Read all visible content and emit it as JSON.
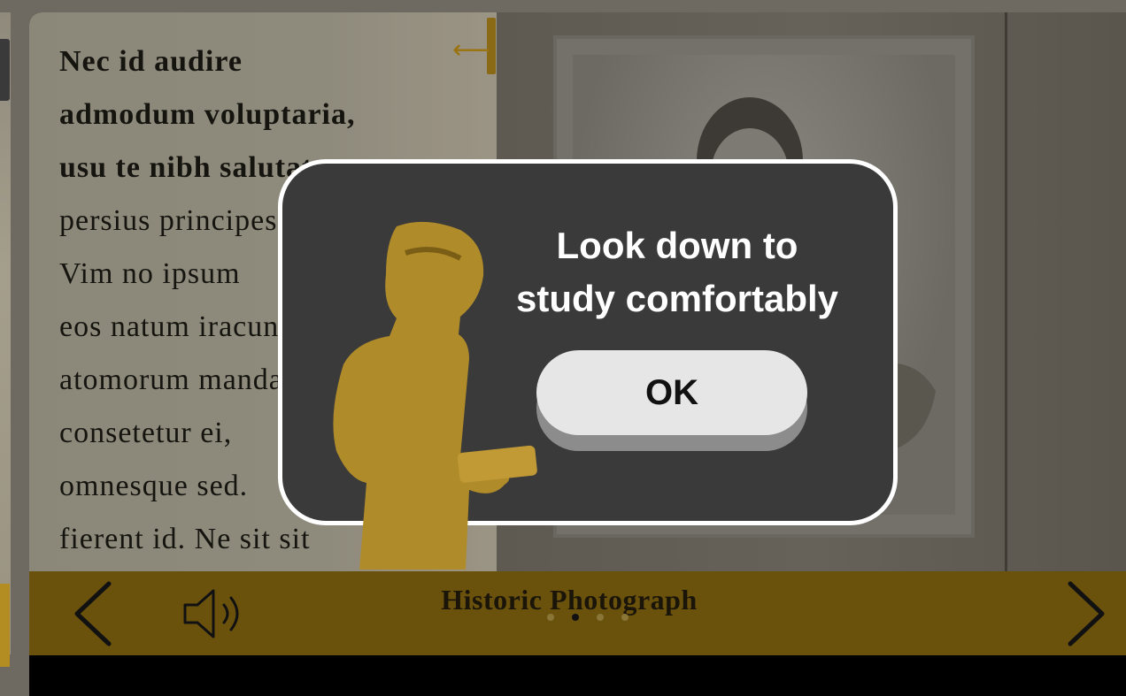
{
  "reader": {
    "body_lines": [
      {
        "text": "Nec id audire",
        "bold": true
      },
      {
        "text": "admodum voluptaria,",
        "bold": true
      },
      {
        "text": "usu te nibh salutatus",
        "bold": true
      },
      {
        "text": "persius principes",
        "bold": false
      },
      {
        "text": "Vim no ipsum",
        "bold": false
      },
      {
        "text": "eos natum iracundia",
        "bold": false
      },
      {
        "text": "atomorum mandamus",
        "bold": false
      },
      {
        "text": "consetetur ei,",
        "bold": false
      },
      {
        "text": "omnesque sed.",
        "bold": false
      },
      {
        "text": "fierent id. Ne sit sit",
        "bold": false
      }
    ]
  },
  "bottom_bar": {
    "title": "Historic Photograph",
    "page_dots": {
      "count": 4,
      "active_index": 1
    }
  },
  "modal": {
    "title": "Look down to\nstudy comfortably",
    "ok_label": "OK"
  },
  "icons": {
    "back": "arrow-left-icon",
    "prev": "chevron-left-icon",
    "next": "chevron-right-icon",
    "audio": "speaker-icon"
  },
  "colors": {
    "accent_gold": "#b38d22",
    "modal_bg": "#3a3a3a",
    "ok_button": "#e6e6e6"
  }
}
